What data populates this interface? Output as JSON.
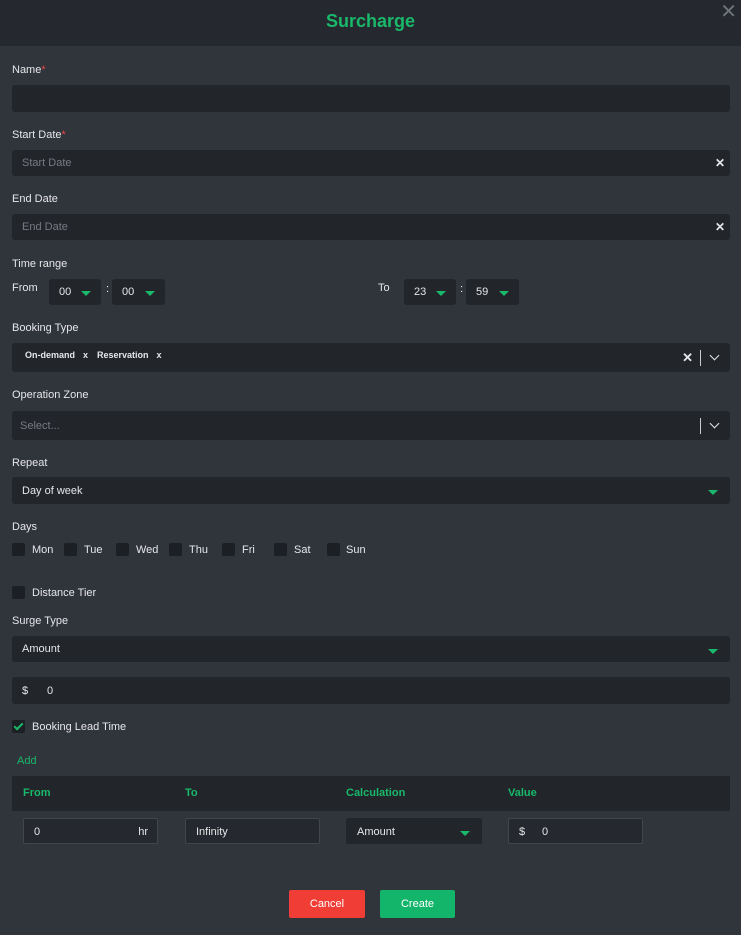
{
  "dialog": {
    "title": "Surcharge",
    "close_symbol": "✕"
  },
  "form": {
    "name_label": "Name",
    "required_mark": "*",
    "start_date_label": "Start Date",
    "start_date_placeholder": "Start Date",
    "end_date_label": "End Date",
    "end_date_placeholder": "End Date",
    "clear_symbol": "✕",
    "time_range_label": "Time range",
    "from_label": "From",
    "to_label": "To",
    "colon": ":",
    "from_hour": "00",
    "from_minute": "00",
    "to_hour": "23",
    "to_minute": "59",
    "booking_type_label": "Booking Type",
    "booking_types": [
      "On-demand",
      "Reservation"
    ],
    "chip_remove": "x",
    "operation_zone_label": "Operation Zone",
    "operation_zone_placeholder": "Select...",
    "repeat_label": "Repeat",
    "repeat_value": "Day of week",
    "days_label": "Days",
    "days": [
      {
        "label": "Mon",
        "checked": false
      },
      {
        "label": "Tue",
        "checked": false
      },
      {
        "label": "Wed",
        "checked": false
      },
      {
        "label": "Thu",
        "checked": false
      },
      {
        "label": "Fri",
        "checked": false
      },
      {
        "label": "Sat",
        "checked": false
      },
      {
        "label": "Sun",
        "checked": false
      }
    ],
    "distance_tier_label": "Distance Tier",
    "distance_tier_checked": false,
    "surge_type_label": "Surge Type",
    "surge_type_value": "Amount",
    "currency": "$",
    "amount_value": "0",
    "lead_time_label": "Booking Lead Time",
    "lead_time_checked": true
  },
  "lead_table": {
    "add_label": "Add",
    "headers": [
      "From",
      "To",
      "Calculation",
      "Value"
    ],
    "row": {
      "from_value": "0",
      "from_unit": "hr",
      "to_value": "Infinity",
      "calculation": "Amount",
      "currency": "$",
      "value": "0"
    }
  },
  "actions": {
    "cancel_label": "Cancel",
    "create_label": "Create"
  },
  "colors": {
    "accent": "#19b86a",
    "danger": "#f03d35",
    "background": "#30343b",
    "input": "#22252a"
  }
}
